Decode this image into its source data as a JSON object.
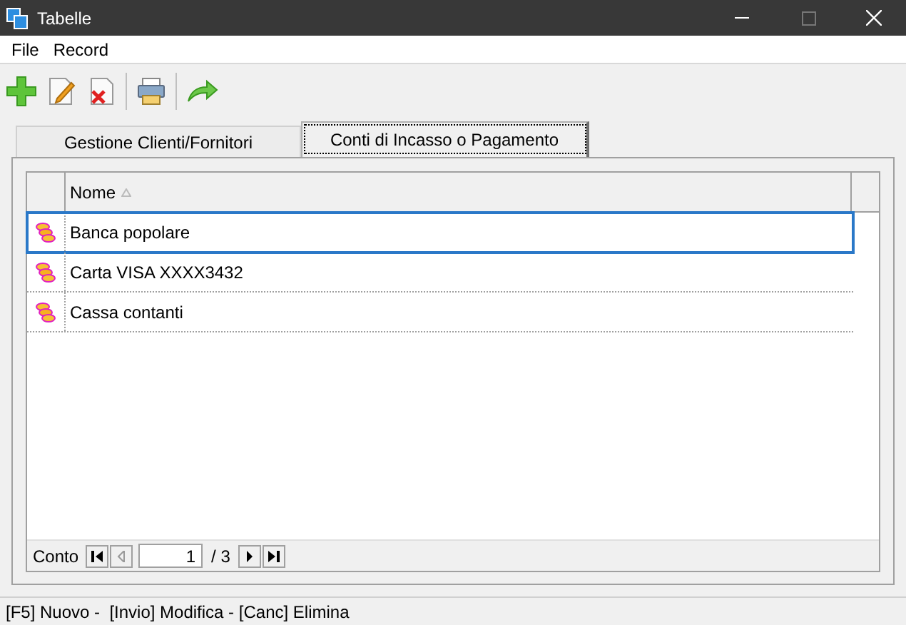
{
  "window": {
    "title": "Tabelle"
  },
  "menu": [
    "File",
    "Record"
  ],
  "tabs": [
    {
      "label": "Gestione Clienti/Fornitori",
      "selected": false
    },
    {
      "label": "Conti di Incasso o Pagamento",
      "selected": true
    }
  ],
  "grid": {
    "columns": [
      {
        "label": "Nome",
        "sorted": true
      }
    ],
    "rows": [
      {
        "name": "Banca popolare",
        "selected": true
      },
      {
        "name": "Carta VISA XXXX3432",
        "selected": false
      },
      {
        "name": "Cassa contanti",
        "selected": false
      }
    ]
  },
  "navigator": {
    "label": "Conto",
    "page": "1",
    "total": "/ 3"
  },
  "status_bar": "[F5] Nuovo -  [Invio] Modifica - [Canc] Elimina"
}
